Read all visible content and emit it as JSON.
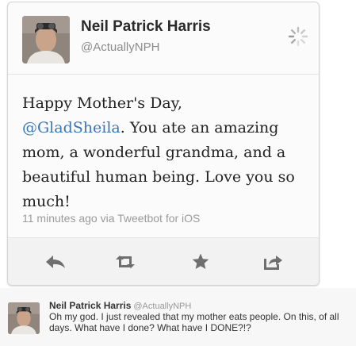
{
  "tweet": {
    "author_name": "Neil Patrick Harris",
    "author_handle": "@ActuallyNPH",
    "text_before": "Happy Mother's Day,",
    "mention": "@GladSheila",
    "text_after": ". You ate an amazing mom, a wonderful grandma, and a beautiful human being. Love you so much!",
    "meta": "11 minutes ago via Tweetbot for iOS",
    "actions": [
      {
        "name": "reply",
        "icon": "reply-icon"
      },
      {
        "name": "retweet",
        "icon": "retweet-icon"
      },
      {
        "name": "favorite",
        "icon": "star-icon"
      },
      {
        "name": "share",
        "icon": "share-icon"
      }
    ],
    "colors": {
      "mention": "#3a76b6",
      "icons": "#6f6f6f"
    }
  },
  "followup": {
    "author_name": "Neil Patrick Harris",
    "author_handle": "@ActuallyNPH",
    "text": "Oh my god. I just revealed that my mother eats people. On this, of all days. What have I done? What have I DONE?!?"
  }
}
